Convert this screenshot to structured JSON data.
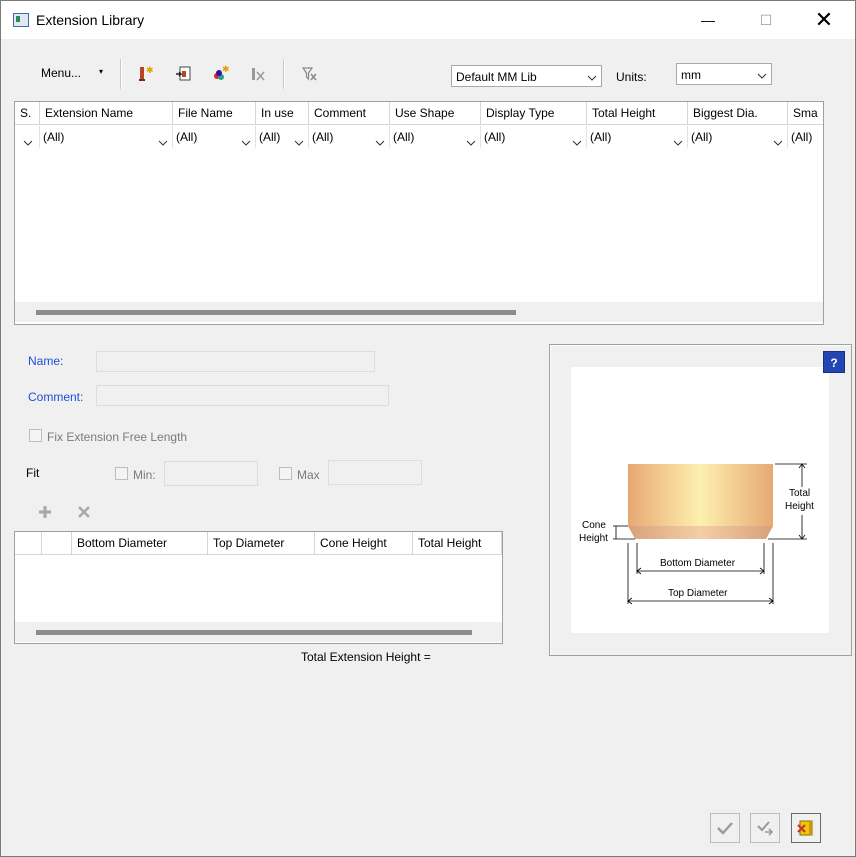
{
  "window": {
    "title": "Extension Library",
    "minimize": "—",
    "maximize": "☐",
    "close": "✕"
  },
  "toolbar": {
    "menu_label": "Menu...",
    "menu_caret": "▾",
    "icons": [
      "new-extension-icon",
      "import-icon",
      "color-palette-icon",
      "delete-extension-icon",
      "clear-filter-icon"
    ]
  },
  "library_select": {
    "value": "Default MM Lib"
  },
  "units": {
    "label": "Units:",
    "value": "mm"
  },
  "extension_grid": {
    "columns": [
      "S.",
      "Extension Name",
      "File Name",
      "In use",
      "Comment",
      "Use Shape",
      "Display Type",
      "Total Height",
      "Biggest Dia.",
      "Sma"
    ],
    "filters": [
      "",
      "(All)",
      "(All)",
      "(All)",
      "(All)",
      "(All)",
      "(All)",
      "(All)",
      "(All)",
      "(All)"
    ]
  },
  "details": {
    "name_label": "Name:",
    "comment_label": "Comment:",
    "fix_length_label": "Fix Extension Free Length",
    "fit_label": "Fit",
    "min_label": "Min:",
    "max_label": "Max"
  },
  "segments_grid": {
    "columns": [
      "",
      "",
      "Bottom Diameter",
      "Top Diameter",
      "Cone Height",
      "Total Height"
    ]
  },
  "total_height_label": "Total Extension Height =",
  "diagram": {
    "cone_height": "Cone\nHeight",
    "total_height": "Total\nHeight",
    "bottom_diameter": "Bottom Diameter",
    "top_diameter": "Top Diameter"
  },
  "help_label": "?",
  "colors": {
    "accent_blue": "#1f4ed8",
    "help_blue": "#2446b5"
  }
}
